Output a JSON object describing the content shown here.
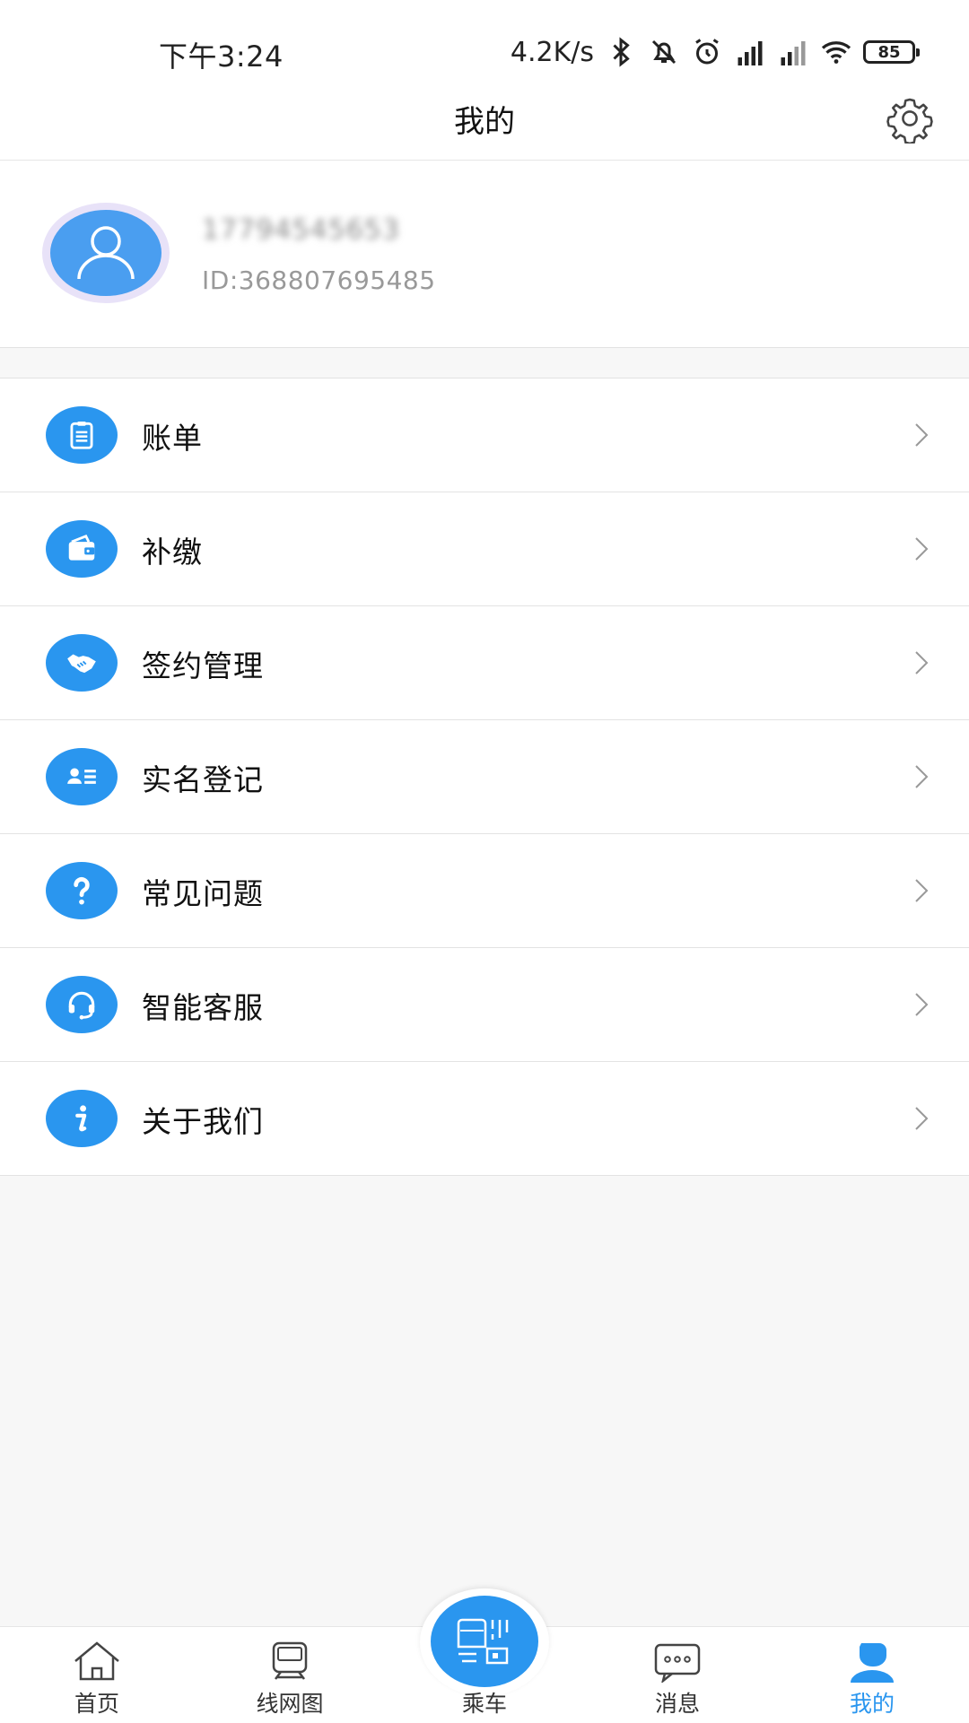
{
  "status_bar": {
    "time": "下午3:24",
    "net_speed": "4.2K/s",
    "battery": "85",
    "icons": [
      "bluetooth-icon",
      "mute-icon",
      "alarm-icon",
      "signal-hd-icon",
      "signal-hd-2-icon",
      "wifi-icon",
      "battery-icon"
    ]
  },
  "header": {
    "title": "我的"
  },
  "profile": {
    "phone": "17794545653",
    "id": "ID:368807695485"
  },
  "menu": [
    {
      "label": "账单",
      "icon": "bill-icon"
    },
    {
      "label": "补缴",
      "icon": "wallet-icon"
    },
    {
      "label": "签约管理",
      "icon": "handshake-icon"
    },
    {
      "label": "实名登记",
      "icon": "id-card-icon"
    },
    {
      "label": "常见问题",
      "icon": "question-icon"
    },
    {
      "label": "智能客服",
      "icon": "headset-icon"
    },
    {
      "label": "关于我们",
      "icon": "info-icon"
    }
  ],
  "bottom_nav": [
    {
      "label": "首页",
      "icon": "home-icon"
    },
    {
      "label": "线网图",
      "icon": "metro-map-icon"
    },
    {
      "label": "乘车",
      "icon": "ride-qr-icon"
    },
    {
      "label": "消息",
      "icon": "message-icon"
    },
    {
      "label": "我的",
      "icon": "user-icon",
      "active": true
    }
  ],
  "colors": {
    "accent": "#2a96ef",
    "avatar_ring": "#e8e2f8",
    "background": "#f7f7f7"
  }
}
